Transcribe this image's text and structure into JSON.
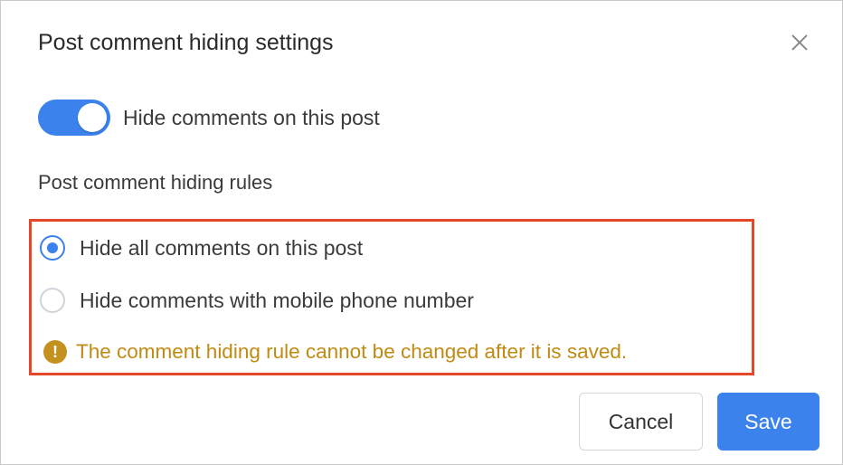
{
  "dialog": {
    "title": "Post comment hiding settings",
    "close_icon": "close-icon"
  },
  "toggle": {
    "label": "Hide comments on this post",
    "checked": true
  },
  "rules": {
    "heading": "Post comment hiding rules",
    "options": [
      {
        "label": "Hide all comments on this post",
        "selected": true
      },
      {
        "label": "Hide comments with mobile phone number",
        "selected": false
      }
    ],
    "warning": {
      "icon": "!",
      "text": "The comment hiding rule cannot be changed after it is saved."
    }
  },
  "buttons": {
    "cancel": "Cancel",
    "save": "Save"
  },
  "colors": {
    "accent": "#3b82ed",
    "warning": "#c08a13",
    "highlight_border": "#e5472a"
  }
}
